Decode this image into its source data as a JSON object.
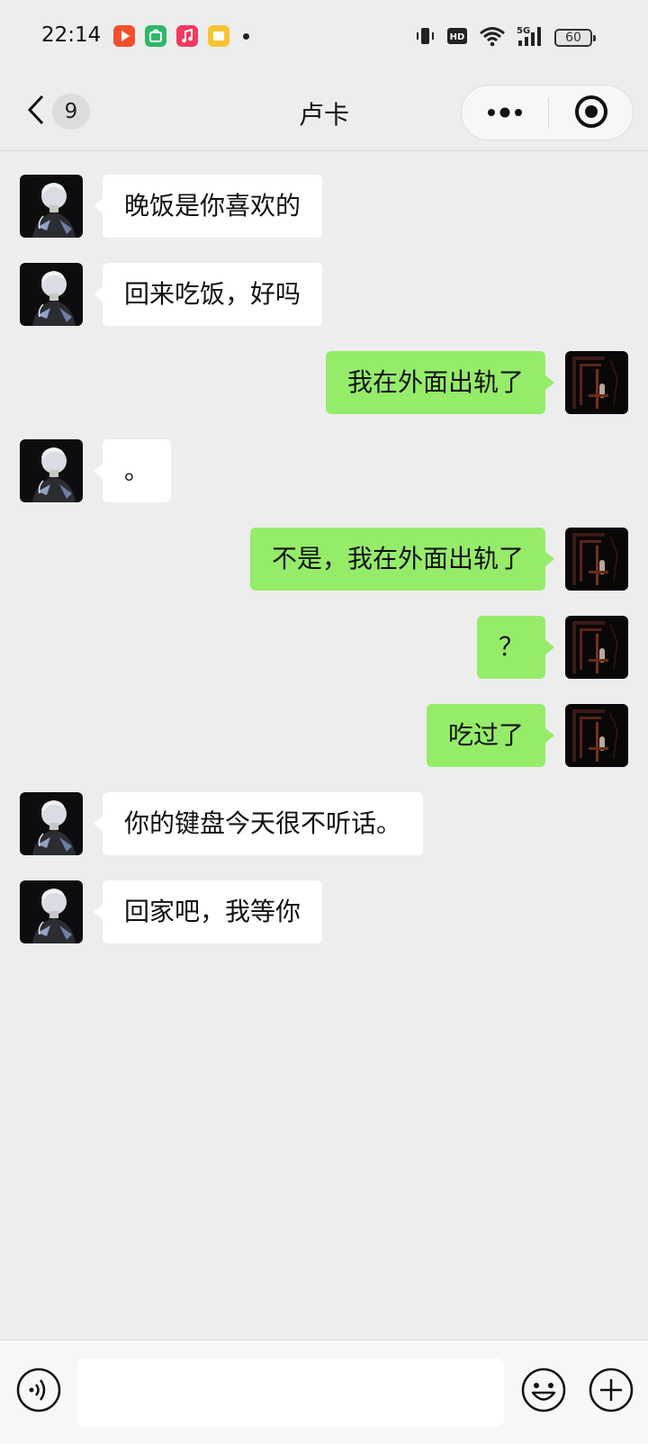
{
  "status_bar": {
    "time": "22:14",
    "app_icons": [
      "video-app-icon",
      "market-app-icon",
      "music-app-icon",
      "notes-app-icon"
    ],
    "network": "5G",
    "hd_label": "HD",
    "battery": "60"
  },
  "nav": {
    "back_count": "9",
    "title": "卢卡"
  },
  "messages": [
    {
      "side": "in",
      "text": "晚饭是你喜欢的"
    },
    {
      "side": "in",
      "text": "回来吃饭，好吗"
    },
    {
      "side": "out",
      "text": "我在外面出轨了"
    },
    {
      "side": "in",
      "text": "。"
    },
    {
      "side": "out",
      "text": "不是，我在外面出轨了"
    },
    {
      "side": "out",
      "text": "？"
    },
    {
      "side": "out",
      "text": "吃过了"
    },
    {
      "side": "in",
      "text": "你的键盘今天很不听话。"
    },
    {
      "side": "in",
      "text": "回家吧，我等你"
    }
  ],
  "input": {
    "value": "",
    "placeholder": ""
  },
  "colors": {
    "background": "#ededed",
    "incoming_bubble": "#ffffff",
    "outgoing_bubble": "#95ec69"
  }
}
